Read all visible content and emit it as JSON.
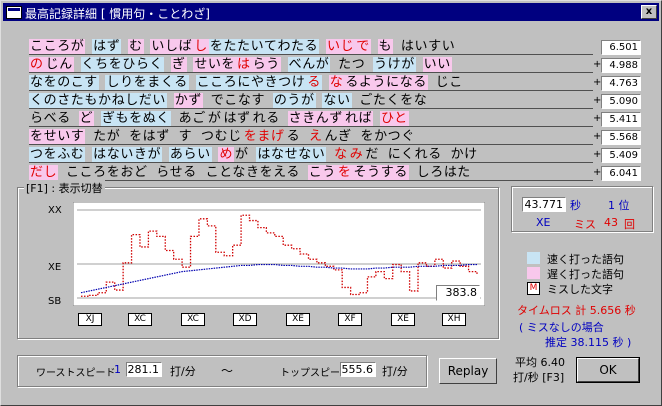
{
  "window": {
    "title": "最高記録詳細 [ 慣用句・ことわざ]",
    "close_label": "x"
  },
  "text_rows": [
    {
      "time": "6.501",
      "plus": "",
      "segs": [
        {
          "t": "こころが",
          "c": "slow"
        },
        {
          "t": " ",
          "c": "normal"
        },
        {
          "t": "はず",
          "c": "fast"
        },
        {
          "t": " ",
          "c": "normal"
        },
        {
          "t": "む",
          "c": "slow"
        },
        {
          "t": " ",
          "c": "normal"
        },
        {
          "t": "いしば",
          "c": "slow"
        },
        {
          "t": "し",
          "c": "slow",
          "m": "し"
        },
        {
          "t": "をたたいてわたる",
          "c": "fast"
        },
        {
          "t": " ",
          "c": "normal"
        },
        {
          "t": "いじ",
          "c": "slow",
          "m": "じ"
        },
        {
          "t": "で",
          "c": "slow",
          "m": "で"
        },
        {
          "t": " ",
          "c": "normal"
        },
        {
          "t": "も",
          "c": "slow"
        },
        {
          "t": " ",
          "c": "normal"
        },
        {
          "t": "はいすい",
          "c": "normal"
        }
      ]
    },
    {
      "time": "4.988",
      "plus": "+",
      "segs": [
        {
          "t": "の",
          "c": "slow",
          "m": "の"
        },
        {
          "t": "じん",
          "c": "slow"
        },
        {
          "t": " ",
          "c": "normal"
        },
        {
          "t": "くちをひらく",
          "c": "fast"
        },
        {
          "t": " ",
          "c": "normal"
        },
        {
          "t": "ぎ",
          "c": "slow"
        },
        {
          "t": " ",
          "c": "normal"
        },
        {
          "t": "せいを",
          "c": "slow"
        },
        {
          "t": "は",
          "c": "slow",
          "m": "は"
        },
        {
          "t": "らう",
          "c": "slow"
        },
        {
          "t": " ",
          "c": "normal"
        },
        {
          "t": "べんが",
          "c": "fast"
        },
        {
          "t": " ",
          "c": "normal"
        },
        {
          "t": "たつ",
          "c": "normal"
        },
        {
          "t": " ",
          "c": "normal"
        },
        {
          "t": "うけが",
          "c": "fast"
        },
        {
          "t": " ",
          "c": "normal"
        },
        {
          "t": "いい",
          "c": "slow"
        }
      ]
    },
    {
      "time": "4.763",
      "plus": "+",
      "segs": [
        {
          "t": "なをのこす",
          "c": "fast"
        },
        {
          "t": " ",
          "c": "normal"
        },
        {
          "t": "しりをまくる",
          "c": "fast"
        },
        {
          "t": " ",
          "c": "normal"
        },
        {
          "t": "こころにやきつけ",
          "c": "fast"
        },
        {
          "t": "る",
          "c": "fast",
          "m": "る"
        },
        {
          "t": " ",
          "c": "normal"
        },
        {
          "t": "な",
          "c": "slow",
          "m": "な"
        },
        {
          "t": "るようになる",
          "c": "slow"
        },
        {
          "t": " ",
          "c": "normal"
        },
        {
          "t": "じこ",
          "c": "normal"
        }
      ]
    },
    {
      "time": "5.090",
      "plus": "+",
      "segs": [
        {
          "t": "くのさたもかねしだい",
          "c": "fast"
        },
        {
          "t": " ",
          "c": "normal"
        },
        {
          "t": "かず",
          "c": "slow"
        },
        {
          "t": " ",
          "c": "normal"
        },
        {
          "t": "でこなす",
          "c": "normal"
        },
        {
          "t": " ",
          "c": "normal"
        },
        {
          "t": "のうが",
          "c": "fast"
        },
        {
          "t": " ",
          "c": "normal"
        },
        {
          "t": "ない",
          "c": "fast"
        },
        {
          "t": " ",
          "c": "normal"
        },
        {
          "t": "ごたくをな",
          "c": "normal"
        }
      ]
    },
    {
      "time": "5.411",
      "plus": "+",
      "segs": [
        {
          "t": "らべる",
          "c": "normal"
        },
        {
          "t": " ",
          "c": "normal"
        },
        {
          "t": "ど",
          "c": "slow"
        },
        {
          "t": " ",
          "c": "normal"
        },
        {
          "t": "ぎもをぬく",
          "c": "fast"
        },
        {
          "t": " ",
          "c": "normal"
        },
        {
          "t": "あご",
          "c": "normal"
        },
        {
          "t": "が",
          "c": "normal"
        },
        {
          "t": "はず",
          "c": "normal"
        },
        {
          "t": "れる",
          "c": "normal"
        },
        {
          "t": " ",
          "c": "normal"
        },
        {
          "t": "さきんず",
          "c": "slow"
        },
        {
          "t": "れば",
          "c": "slow"
        },
        {
          "t": " ",
          "c": "normal"
        },
        {
          "t": "ひと",
          "c": "slow",
          "m": "ひと"
        }
      ]
    },
    {
      "time": "5.568",
      "plus": "+",
      "segs": [
        {
          "t": "をせいす",
          "c": "slow"
        },
        {
          "t": " ",
          "c": "normal"
        },
        {
          "t": "たが",
          "c": "normal"
        },
        {
          "t": " ",
          "c": "normal"
        },
        {
          "t": "をはず",
          "c": "normal"
        },
        {
          "t": " ",
          "c": "normal"
        },
        {
          "t": "す",
          "c": "normal"
        },
        {
          "t": " ",
          "c": "normal"
        },
        {
          "t": "つむじ",
          "c": "normal"
        },
        {
          "t": "をまげ",
          "c": "normal",
          "m": "げ"
        },
        {
          "t": "る",
          "c": "normal"
        },
        {
          "t": " ",
          "c": "normal"
        },
        {
          "t": "え",
          "c": "normal",
          "m": "え"
        },
        {
          "t": "んぎ",
          "c": "normal"
        },
        {
          "t": " ",
          "c": "normal"
        },
        {
          "t": "をかつぐ",
          "c": "normal"
        }
      ]
    },
    {
      "time": "5.409",
      "plus": "+",
      "segs": [
        {
          "t": "つをふむ",
          "c": "fast"
        },
        {
          "t": " ",
          "c": "normal"
        },
        {
          "t": "はないきが",
          "c": "fast"
        },
        {
          "t": " ",
          "c": "normal"
        },
        {
          "t": "あらい",
          "c": "fast"
        },
        {
          "t": " ",
          "c": "normal"
        },
        {
          "t": "め",
          "c": "slow",
          "m": "め"
        },
        {
          "t": "が",
          "c": "normal"
        },
        {
          "t": " ",
          "c": "normal"
        },
        {
          "t": "はなせない",
          "c": "fast"
        },
        {
          "t": " ",
          "c": "normal"
        },
        {
          "t": "な",
          "c": "normal",
          "m": "な"
        },
        {
          "t": "み",
          "c": "normal",
          "m": "み"
        },
        {
          "t": "だ",
          "c": "normal"
        },
        {
          "t": " ",
          "c": "normal"
        },
        {
          "t": "にくれる",
          "c": "normal"
        },
        {
          "t": " ",
          "c": "normal"
        },
        {
          "t": "かけ",
          "c": "normal"
        }
      ]
    },
    {
      "time": "6.041",
      "plus": "+",
      "segs": [
        {
          "t": "だし",
          "c": "slow",
          "m": "だし"
        },
        {
          "t": " ",
          "c": "normal"
        },
        {
          "t": "こころをおど",
          "c": "normal"
        },
        {
          "t": " ",
          "c": "normal"
        },
        {
          "t": "らせる",
          "c": "normal"
        },
        {
          "t": " ",
          "c": "normal"
        },
        {
          "t": "ことなきをえる",
          "c": "normal"
        },
        {
          "t": " ",
          "c": "normal"
        },
        {
          "t": "こう",
          "c": "slow"
        },
        {
          "t": "を",
          "c": "slow",
          "m": "を"
        },
        {
          "t": "そうする",
          "c": "slow"
        },
        {
          "t": " ",
          "c": "normal"
        },
        {
          "t": "しろはた",
          "c": "normal"
        }
      ]
    }
  ],
  "graph": {
    "group_label": "[F1] : 表示切替",
    "y_labels": [
      "XX",
      "XE",
      "SB"
    ],
    "x_labels": [
      "XJ",
      "XC",
      "XC",
      "XD",
      "XE",
      "XF",
      "XE",
      "XH"
    ],
    "readout": "383.8"
  },
  "chart_data": {
    "type": "line",
    "title": "",
    "xlabel": "",
    "ylabel": "",
    "y_levels": [
      "SB",
      "XE",
      "XX"
    ],
    "series": [
      {
        "values": [
          2,
          3,
          6,
          18,
          9,
          40,
          72,
          58,
          76,
          70,
          54,
          44,
          35,
          70,
          90,
          82,
          52,
          48,
          60,
          94,
          88,
          80,
          74,
          70,
          60,
          56,
          50,
          44,
          40,
          36,
          32,
          12,
          4,
          6,
          24,
          30,
          22,
          38,
          30,
          8,
          40,
          36,
          44,
          34,
          42,
          36,
          30,
          26
        ]
      },
      {
        "values": [
          6,
          8,
          10,
          12,
          14,
          16,
          18,
          20,
          22,
          24,
          26,
          28,
          30,
          31,
          32,
          33,
          34,
          35,
          36,
          37,
          37,
          38,
          38,
          38,
          37,
          37,
          36,
          36,
          35,
          35,
          34,
          34,
          33,
          33,
          33,
          34,
          34,
          35,
          35,
          35,
          36,
          36,
          36,
          37,
          37,
          37,
          38,
          38
        ]
      }
    ],
    "ylim": [
      0,
      100
    ],
    "colors": {
      "typing": "#d00000",
      "average": "#0000b0"
    }
  },
  "summary": {
    "time": "43.771",
    "time_unit": "秒",
    "rank": "1 位",
    "level": "XE",
    "miss_label": "ミス",
    "miss_count": "43",
    "miss_unit": "回"
  },
  "legend": {
    "fast_label": "速く打った語句",
    "slow_label": "遅く打った語句",
    "miss_mark": "M",
    "miss_label": "ミスした文字",
    "colors": {
      "fast": "#c8e4f4",
      "slow": "#f8c8ec"
    }
  },
  "timeloss": {
    "line1": "タイムロス  計  5.656 秒",
    "line2": "( ミスなしの場合",
    "line3": "推定    38.115 秒 )"
  },
  "speeds": {
    "worst_label": "ワーストスピード",
    "worst_rank": "1",
    "worst_value": "281.1",
    "unit1": "打/分",
    "tilde": "～",
    "top_label": "トップスピード",
    "top_value": "555.6",
    "unit2": "打/分"
  },
  "buttons": {
    "replay": "Replay",
    "ok": "OK"
  },
  "average": {
    "line1": "平均  6.40",
    "line2": "打/秒  [F3]"
  }
}
